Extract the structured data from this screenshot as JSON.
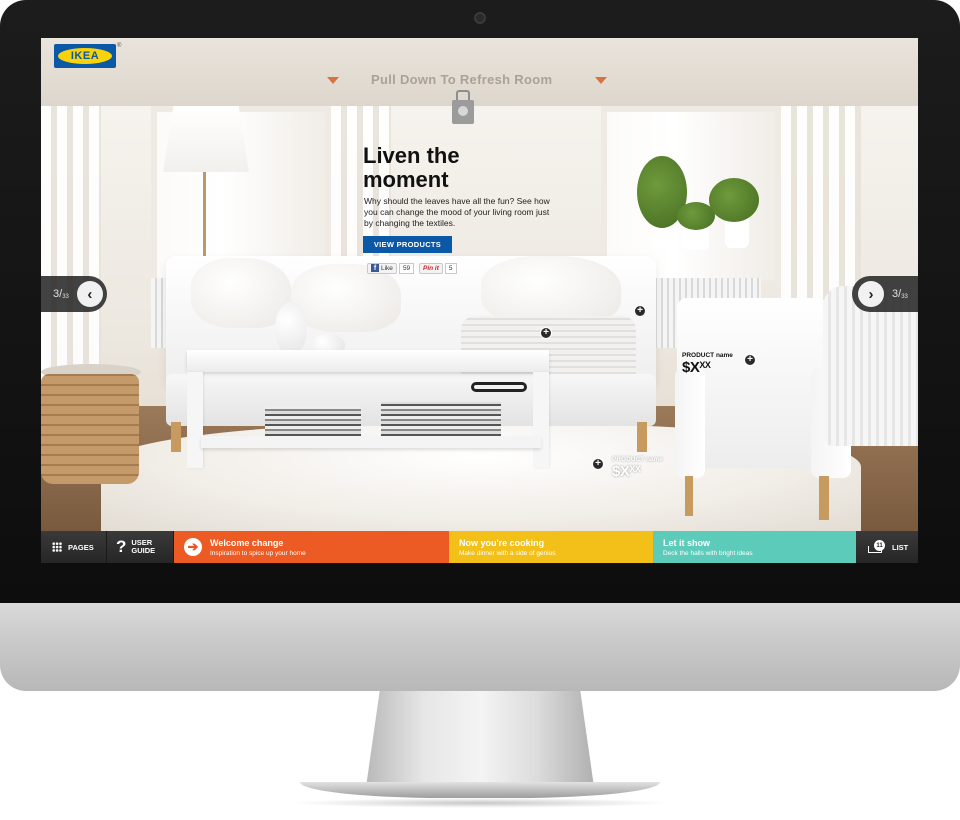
{
  "app": {
    "brand": "IKEA"
  },
  "top_bar": {
    "pull_text": "Pull Down To Refresh Room"
  },
  "hero": {
    "title": "Liven the moment",
    "description": "Why should the leaves have all the fun? See how you can change the mood of your living room just by changing the textiles.",
    "cta_label": "VIEW PRODUCTS",
    "facebook_label": "Like",
    "facebook_count": "59",
    "pinterest_label": "Pin it",
    "pinterest_count": "5"
  },
  "pager": {
    "current": "3",
    "total": "33"
  },
  "product_tags": [
    {
      "name": "PRODUCT name",
      "price_symbol": "$",
      "price_main": "X",
      "price_sup": "XX"
    },
    {
      "name": "PRODUCT name",
      "price_symbol": "$",
      "price_main": "X",
      "price_sup": "XX"
    }
  ],
  "hotspot_symbol": "+",
  "bottom_nav": {
    "pages_label": "PAGES",
    "guide_label_1": "USER",
    "guide_label_2": "GUIDE",
    "list_label": "LIST",
    "list_count": "11",
    "features": [
      {
        "title": "Welcome change",
        "subtitle": "Inspiration to spice up your home",
        "color": "#ec5b24"
      },
      {
        "title": "Now you're cooking",
        "subtitle": "Make dinner with a side of genius",
        "color": "#f2c018"
      },
      {
        "title": "Let it show",
        "subtitle": "Deck the halls with bright ideas",
        "color": "#5ccbb9"
      }
    ]
  },
  "colors": {
    "ikea_blue": "#0b58a6",
    "ikea_yellow": "#f8d20a",
    "accent_orange": "#d8733d"
  }
}
